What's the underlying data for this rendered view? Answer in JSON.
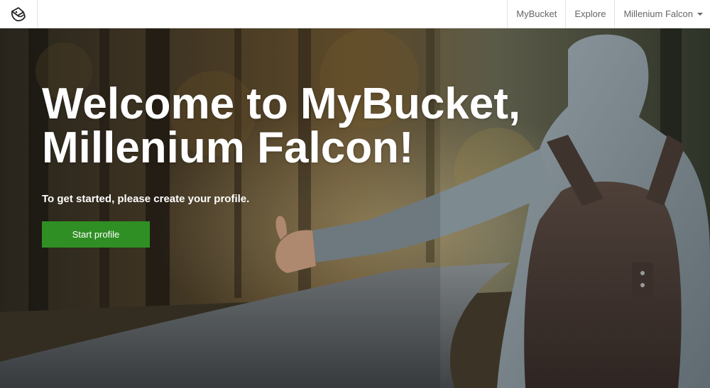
{
  "navbar": {
    "logo_icon": "bucket-logo-icon",
    "links": [
      {
        "label": "MyBucket"
      },
      {
        "label": "Explore"
      },
      {
        "label": "Millenium Falcon",
        "icon": "caret-down-icon"
      }
    ]
  },
  "hero": {
    "title_line1": "Welcome to MyBucket,",
    "title_line2": "Millenium Falcon!",
    "subtitle": "To get started, please create your profile.",
    "button_label": "Start profile",
    "colors": {
      "button": "#2f8f24",
      "text": "#ffffff"
    }
  }
}
